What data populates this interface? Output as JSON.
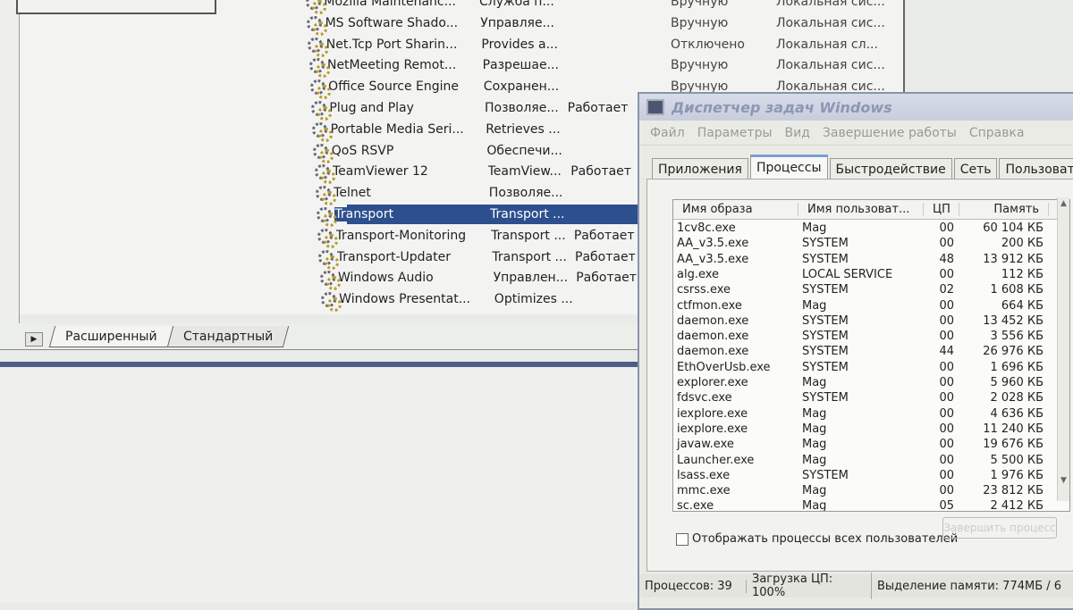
{
  "services": {
    "rows": [
      {
        "name": "Mozilla Maintenanc...",
        "desc": "Служба п...",
        "status": "",
        "startup": "Вручную",
        "logon": "Локальная сис..."
      },
      {
        "name": "MS Software Shado...",
        "desc": "Управляе...",
        "status": "",
        "startup": "Вручную",
        "logon": "Локальная сис..."
      },
      {
        "name": "Net.Tcp Port Sharin...",
        "desc": "Provides a...",
        "status": "",
        "startup": "Отключено",
        "logon": "Локальная сл..."
      },
      {
        "name": "NetMeeting Remot...",
        "desc": "Разрешае...",
        "status": "",
        "startup": "Вручную",
        "logon": "Локальная сис..."
      },
      {
        "name": "Office Source Engine",
        "desc": "Сохранен...",
        "status": "",
        "startup": "Вручную",
        "logon": "Локальная сис..."
      },
      {
        "name": "Plug and Play",
        "desc": "Позволяе...",
        "status": "Работает"
      },
      {
        "name": "Portable Media Seri...",
        "desc": "Retrieves ...",
        "status": ""
      },
      {
        "name": "QoS RSVP",
        "desc": "Обеспечи...",
        "status": ""
      },
      {
        "name": "TeamViewer 12",
        "desc": "TeamView...",
        "status": "Работает"
      },
      {
        "name": "Telnet",
        "desc": "Позволяе...",
        "status": ""
      },
      {
        "name": "Transport",
        "desc": "Transport ...",
        "status": "",
        "selected": true
      },
      {
        "name": "Transport-Monitoring",
        "desc": "Transport ...",
        "status": "Работает"
      },
      {
        "name": "Transport-Updater",
        "desc": "Transport ...",
        "status": "Работает"
      },
      {
        "name": "Windows Audio",
        "desc": "Управлен...",
        "status": "Работает"
      },
      {
        "name": "Windows Presentat...",
        "desc": "Optimizes ...",
        "status": ""
      }
    ],
    "tabs": [
      "Расширенный",
      "Стандартный"
    ],
    "selected_color": "#2d4f8e"
  },
  "taskmgr": {
    "title": "Диспетчер задач Windows",
    "menu": [
      "Файл",
      "Параметры",
      "Вид",
      "Завершение работы",
      "Справка"
    ],
    "tabs": [
      "Приложения",
      "Процессы",
      "Быстродействие",
      "Сеть",
      "Пользователи"
    ],
    "active_tab": "Процессы",
    "columns": [
      "Имя образа",
      "Имя пользоват...",
      "ЦП",
      "Память"
    ],
    "processes": [
      [
        "1cv8c.exe",
        "Mag",
        "00",
        "60 104 КБ"
      ],
      [
        "AA_v3.5.exe",
        "SYSTEM",
        "00",
        "200 КБ"
      ],
      [
        "AA_v3.5.exe",
        "SYSTEM",
        "48",
        "13 912 КБ"
      ],
      [
        "alg.exe",
        "LOCAL SERVICE",
        "00",
        "112 КБ"
      ],
      [
        "csrss.exe",
        "SYSTEM",
        "02",
        "1 608 КБ"
      ],
      [
        "ctfmon.exe",
        "Mag",
        "00",
        "664 КБ"
      ],
      [
        "daemon.exe",
        "SYSTEM",
        "00",
        "13 452 КБ"
      ],
      [
        "daemon.exe",
        "SYSTEM",
        "00",
        "3 556 КБ"
      ],
      [
        "daemon.exe",
        "SYSTEM",
        "44",
        "26 976 КБ"
      ],
      [
        "EthOverUsb.exe",
        "SYSTEM",
        "00",
        "1 696 КБ"
      ],
      [
        "explorer.exe",
        "Mag",
        "00",
        "5 960 КБ"
      ],
      [
        "fdsvc.exe",
        "SYSTEM",
        "00",
        "2 028 КБ"
      ],
      [
        "iexplore.exe",
        "Mag",
        "00",
        "4 636 КБ"
      ],
      [
        "iexplore.exe",
        "Mag",
        "00",
        "11 240 КБ"
      ],
      [
        "javaw.exe",
        "Mag",
        "00",
        "19 676 КБ"
      ],
      [
        "Launcher.exe",
        "Mag",
        "00",
        "5 500 КБ"
      ],
      [
        "lsass.exe",
        "SYSTEM",
        "00",
        "1 976 КБ"
      ],
      [
        "mmc.exe",
        "Mag",
        "00",
        "23 812 КБ"
      ],
      [
        "sc.exe",
        "Mag",
        "05",
        "2 412 КБ"
      ],
      [
        "",
        "",
        "",
        ""
      ]
    ],
    "show_all_label": "Отображать процессы всех пользователей",
    "show_all_checked": false,
    "end_process_label": "Завершить процесс",
    "status": {
      "processes": "Процессов: 39",
      "cpu": "Загрузка ЦП: 100%",
      "memory": "Выделение памяти: 774МБ / 6"
    }
  }
}
